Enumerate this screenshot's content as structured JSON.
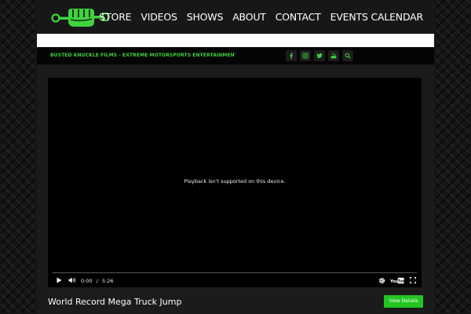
{
  "nav": {
    "items": [
      "STORE",
      "VIDEOS",
      "SHOWS",
      "ABOUT",
      "CONTACT",
      "EVENTS CALENDAR"
    ]
  },
  "ticker": {
    "text": "BUSTED KNUCKLE FILMS - EXTREME MOTORSPORTS ENTERTAINMENT     F"
  },
  "social": {
    "icons": [
      "facebook-icon",
      "instagram-icon",
      "twitter-icon",
      "youtube-icon",
      "search-icon"
    ]
  },
  "video": {
    "message": "Playback isn't supported on this device.",
    "current_time": "0:00",
    "separator": "/",
    "duration": "5:26",
    "youtube_label": "YouTube"
  },
  "main": {
    "title": "World Record Mega Truck Jump",
    "details_label": "View Details"
  },
  "colors": {
    "accent": "#23c423",
    "ticker": "#3fd33f",
    "logo_green": "#3fd33f"
  }
}
